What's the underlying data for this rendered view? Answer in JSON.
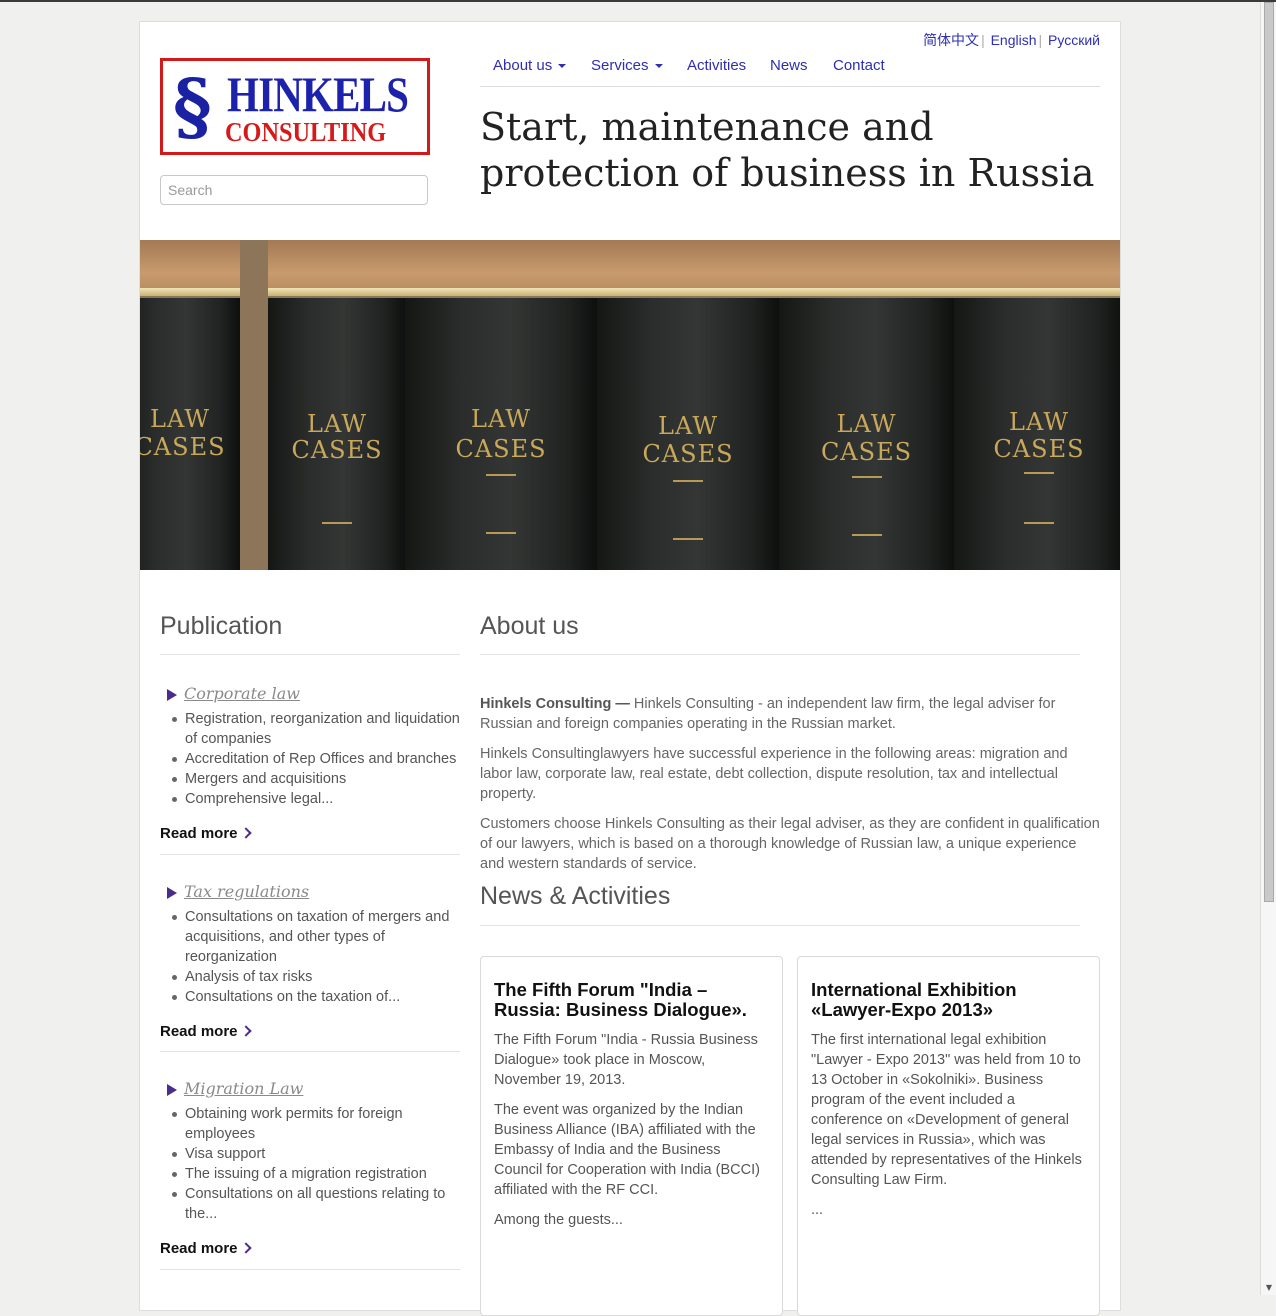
{
  "languages": [
    "简体中文",
    "English",
    "Русский"
  ],
  "logo": {
    "main": "HINKELS",
    "sub": "CONSULTING",
    "mark": "§"
  },
  "search": {
    "placeholder": "Search",
    "value": ""
  },
  "nav": {
    "about": "About us",
    "services": "Services",
    "activities": "Activities",
    "news": "News",
    "contact": "Contact"
  },
  "headline": "Start, maintenance and protection of business in Russia",
  "hero": {
    "book_label_top": "LAW",
    "book_label_bottom": "CASES"
  },
  "sidebar": {
    "title": "Publication",
    "read_more": "Read more",
    "publications": [
      {
        "title": "Corporate law",
        "items": [
          "Registration, reorganization and liquidation of companies",
          "Accreditation of Rep Offices and branches",
          "Mergers and acquisitions",
          "Comprehensive legal..."
        ]
      },
      {
        "title": "Tax regulations",
        "items": [
          "Consultations on taxation of mergers and acquisitions, and other types of reorganization",
          "Analysis of tax risks",
          "Consultations on the taxation of..."
        ]
      },
      {
        "title": "Migration Law",
        "items": [
          "Obtaining work permits for foreign employees",
          "Visa support",
          "The issuing of a migration registration",
          "Consultations on all questions relating to the..."
        ]
      }
    ]
  },
  "about": {
    "title": "About us",
    "lead_bold": "Hinkels Consulting —",
    "paragraph1": " Hinkels Consulting - an independent law firm, the legal adviser for Russian and foreign companies operating in the Russian market.",
    "paragraph2": "Hinkels Consultinglawyers have successful experience in the following areas: migration and labor law, corporate law, real estate, debt collection, dispute resolution, tax and intellectual property.",
    "paragraph3": "Customers choose Hinkels Consulting as their legal adviser, as they are confident in qualification of our lawyers, which is based on a thorough knowledge of Russian law, a unique experience and western standards of service."
  },
  "news": {
    "title": "News & Activities",
    "cards": [
      {
        "title": "The Fifth Forum \"India – Russia: Business Dialogue».",
        "paragraphs": [
          "The Fifth Forum \"India - Russia Business Dialogue» took place in Moscow, November 19, 2013.",
          "The event was organized by the Indian Business Alliance (IBA) affiliated with the Embassy of India and the Business Council for Cooperation with India (BCCI) affiliated with the RF CCI.",
          "Among the guests..."
        ]
      },
      {
        "title": "International Exhibition «Lawyer-Expo 2013»",
        "paragraphs": [
          "The first international legal exhibition \"Lawyer - Expo 2013\" was held from 10 to 13 October in «Sokolniki». Business program of the event included a conference on «Development of general legal services in Russia», which was attended by representatives of the Hinkels Consulting Law Firm.",
          "..."
        ]
      }
    ]
  }
}
